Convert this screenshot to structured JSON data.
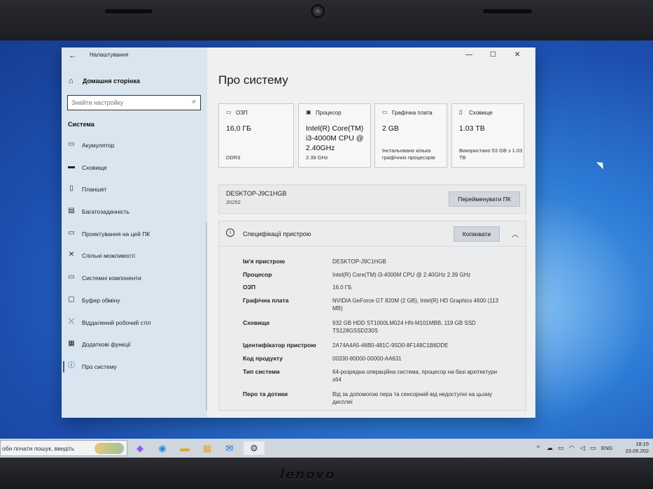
{
  "bezel": {
    "brand": "lenovo"
  },
  "window": {
    "app_title": "Налаштування",
    "controls": {
      "minimize": "—",
      "maximize": "☐",
      "close": "✕"
    }
  },
  "sidebar": {
    "home_label": "Домашня сторінка",
    "search_placeholder": "Знайти настройку",
    "section_title": "Система",
    "items": [
      {
        "label": "Акумулятор",
        "icon": "battery-icon"
      },
      {
        "label": "Сховище",
        "icon": "storage-icon"
      },
      {
        "label": "Планшет",
        "icon": "tablet-icon"
      },
      {
        "label": "Багатозадачність",
        "icon": "multitasking-icon"
      },
      {
        "label": "Проектування на цей ПК",
        "icon": "projecting-icon"
      },
      {
        "label": "Спільні можливості",
        "icon": "shared-experiences-icon"
      },
      {
        "label": "Системні компоненти",
        "icon": "system-components-icon"
      },
      {
        "label": "Буфер обміну",
        "icon": "clipboard-icon"
      },
      {
        "label": "Віддалений робочий стіл",
        "icon": "remote-desktop-icon"
      },
      {
        "label": "Додаткові функції",
        "icon": "optional-features-icon"
      },
      {
        "label": "Про систему",
        "icon": "info-icon",
        "active": true
      }
    ]
  },
  "main": {
    "page_title": "Про систему",
    "cards": [
      {
        "title": "ОЗП",
        "icon": "ram-icon",
        "value": "16,0 ГБ",
        "sub": "DDR3"
      },
      {
        "title": "Процесор",
        "icon": "cpu-icon",
        "value": "Intel(R) Core(TM) i3-4000M CPU @ 2.40GHz",
        "sub": "2.39 GHz"
      },
      {
        "title": "Графічна плата",
        "icon": "gpu-icon",
        "value": "2 GB",
        "sub": "Інстальовано кілька графічних процесорів"
      },
      {
        "title": "Сховище",
        "icon": "storage-icon",
        "value": "1.03 ТВ",
        "sub": "Використано 53 GB з 1.03 ТВ"
      }
    ],
    "device": {
      "name": "DESKTOP-J9C1HGB",
      "sub": "20252",
      "rename_label": "Перейменувати ПК"
    },
    "specs": {
      "title": "Специфікації пристрою",
      "copy_label": "Копіювати",
      "rows": [
        {
          "key": "Ім'я пристрою",
          "value": "DESKTOP-J9C1HGB"
        },
        {
          "key": "Процесор",
          "value": "Intel(R) Core(TM) i3-4000M CPU @ 2.40GHz   2.39 GHz"
        },
        {
          "key": "ОЗП",
          "value": "16.0 ГБ"
        },
        {
          "key": "Графічна плата",
          "value": "NVIDIA GeForce GT 820M (2 GB), Intel(R) HD Graphics 4600 (113 MB)"
        },
        {
          "key": "Сховище",
          "value": "932 GB HDD ST1000LM024 HN-M101MBB, 119 GB SSD TS128GSSD230S"
        },
        {
          "key": "Ідентифікатор пристрою",
          "value": "2A74A4A5-46B0-481C-95D0-8F148C1B6DDE"
        },
        {
          "key": "Код продукту",
          "value": "00330-80000-00000-AA631"
        },
        {
          "key": "Тип системи",
          "value": "64-розрядна операційна система, процесор на базі архітектури x64"
        },
        {
          "key": "Перо та дотики",
          "value": "Від за допомогою пера та сенсорний від недоступні на цьому дисплеї"
        }
      ]
    }
  },
  "taskbar": {
    "search_text": "оби почати пошук, введіть",
    "apps": [
      "copilot-icon",
      "edge-icon",
      "file-explorer-icon",
      "store-icon",
      "mail-icon",
      "settings-icon"
    ],
    "language": "ENG",
    "time": "18:15",
    "date": "23.05.202"
  }
}
